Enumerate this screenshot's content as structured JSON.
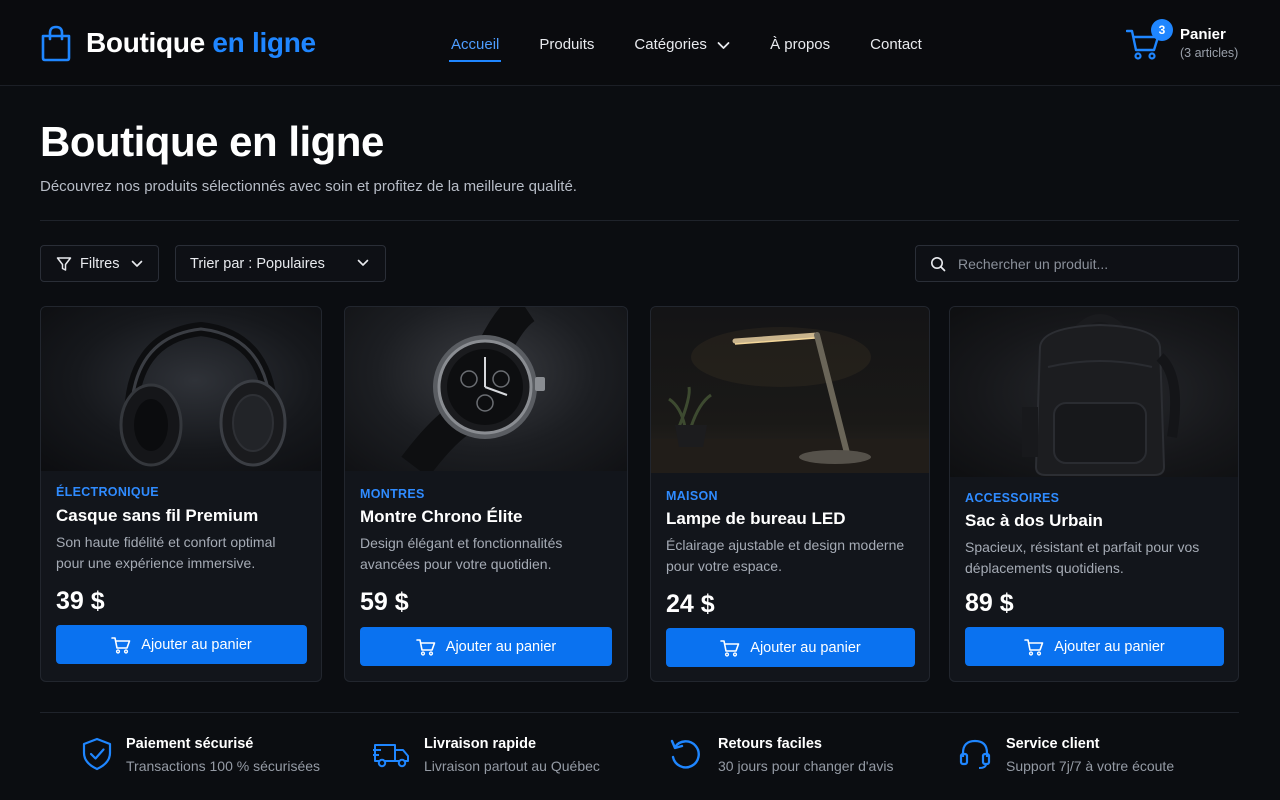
{
  "header": {
    "brand_main": "Boutique",
    "brand_accent": "en ligne",
    "nav": [
      {
        "label": "Accueil",
        "active": true
      },
      {
        "label": "Produits"
      },
      {
        "label": "Catégories"
      },
      {
        "label": "À propos"
      },
      {
        "label": "Contact"
      }
    ],
    "cart": {
      "count": "3",
      "title": "Panier",
      "subtitle": "(3 articles)"
    }
  },
  "hero": {
    "title": "Boutique en ligne",
    "subtitle": "Découvrez nos produits sélectionnés avec soin et profitez de la meilleure qualité."
  },
  "toolbar": {
    "filters_label": "Filtres",
    "sort_label": "Trier par : Populaires",
    "search_placeholder": "Rechercher un produit..."
  },
  "products": [
    {
      "category": "ÉLECTRONIQUE",
      "name": "Casque sans fil Premium",
      "description": "Son haute fidélité et confort optimal pour une expérience immersive.",
      "price": "39 $",
      "button": "Ajouter au panier",
      "image_icon": "headphones"
    },
    {
      "category": "MONTRES",
      "name": "Montre Chrono Élite",
      "description": "Design élégant et fonctionnalités avancées pour votre quotidien.",
      "price": "59 $",
      "button": "Ajouter au panier",
      "image_icon": "wristwatch"
    },
    {
      "category": "MAISON",
      "name": "Lampe de bureau LED",
      "description": "Éclairage ajustable et design moderne pour votre espace.",
      "price": "24 $",
      "button": "Ajouter au panier",
      "image_icon": "desk-lamp"
    },
    {
      "category": "ACCESSOIRES",
      "name": "Sac à dos Urbain",
      "description": "Spacieux, résistant et parfait pour vos déplacements quotidiens.",
      "price": "89 $",
      "button": "Ajouter au panier",
      "image_icon": "backpack"
    }
  ],
  "features": [
    {
      "title": "Paiement sécurisé",
      "subtitle": "Transactions 100 % sécurisées",
      "icon": "shield-check"
    },
    {
      "title": "Livraison rapide",
      "subtitle": "Livraison partout au Québec",
      "icon": "truck"
    },
    {
      "title": "Retours faciles",
      "subtitle": "30 jours pour changer d'avis",
      "icon": "return-arrow"
    },
    {
      "title": "Service client",
      "subtitle": "Support 7j/7 à votre écoute",
      "icon": "headset"
    }
  ],
  "colors": {
    "accent": "#1f86ff",
    "button": "#0a72f0",
    "background": "#0b0d11",
    "card": "#12151b"
  }
}
